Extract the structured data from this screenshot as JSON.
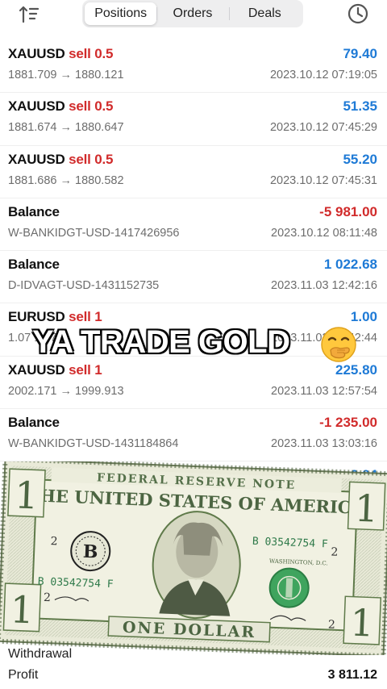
{
  "tabs": [
    {
      "label": "Positions"
    },
    {
      "label": "Orders"
    },
    {
      "label": "Deals"
    }
  ],
  "deals": [
    {
      "symbol": "XAUUSD",
      "side": "sell 0.5",
      "detail": "1881.709 → 1880.121",
      "value": "79.40",
      "date": "2023.10.12 07:19:05",
      "sign": "pos"
    },
    {
      "symbol": "XAUUSD",
      "side": "sell 0.5",
      "detail": "1881.674 → 1880.647",
      "value": "51.35",
      "date": "2023.10.12 07:45:29",
      "sign": "pos"
    },
    {
      "symbol": "XAUUSD",
      "side": "sell 0.5",
      "detail": "1881.686 → 1880.582",
      "value": "55.20",
      "date": "2023.10.12 07:45:31",
      "sign": "pos"
    },
    {
      "symbol": "Balance",
      "side": "",
      "detail": "W-BANKIDGT-USD-1417426956",
      "value": "-5 981.00",
      "date": "2023.10.12 08:11:48",
      "sign": "neg"
    },
    {
      "symbol": "Balance",
      "side": "",
      "detail": "D-IDVAGT-USD-1431152735",
      "value": "1 022.68",
      "date": "2023.11.03 12:42:16",
      "sign": "pos"
    },
    {
      "symbol": "EURUSD",
      "side": "sell 1",
      "detail": "1.07 1.07",
      "value": "1.00",
      "date": "2023.11.03 12:42:44",
      "sign": "pos"
    },
    {
      "symbol": "XAUUSD",
      "side": "sell 1",
      "detail": "2002.171 → 1999.913",
      "value": "225.80",
      "date": "2023.11.03 12:57:54",
      "sign": "pos"
    },
    {
      "symbol": "Balance",
      "side": "",
      "detail": "W-BANKIDGT-USD-1431184864",
      "value": "-1 235.00",
      "date": "2023.11.03 13:03:16",
      "sign": "neg"
    },
    {
      "symbol": "",
      "side": "",
      "detail": "",
      "value": "0.04",
      "date": "",
      "sign": "pos"
    }
  ],
  "overlay": {
    "caption": "YA TRADE GOLD"
  },
  "bill": {
    "header": "FEDERAL RESERVE NOTE",
    "country": "THE UNITED STATES OF AMERICA",
    "serial": "B 03542754 F",
    "seal_letter": "B",
    "denomination": "1",
    "bottom_text": "ONE DOLLAR",
    "city": "WASHINGTON, D.C.",
    "plate": "2"
  },
  "summary": {
    "withdrawal_label": "Withdrawal",
    "profit_label": "Profit",
    "profit_value": "3 811.12"
  },
  "colors": {
    "positive": "#1e7ad6",
    "negative": "#d12b2b",
    "bill_green": "#5f7a4a"
  },
  "icons": [
    "sort-icon",
    "clock-icon",
    "face-with-hand-over-mouth-emoji"
  ]
}
